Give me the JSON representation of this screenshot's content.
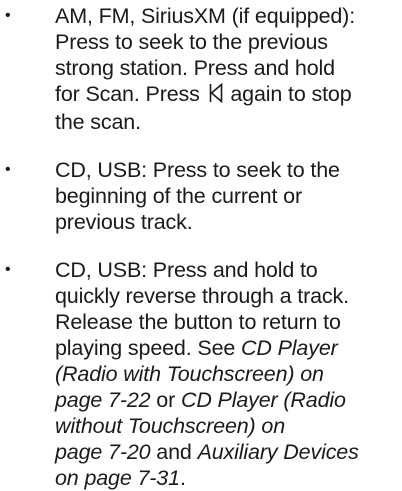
{
  "bullet_char": "•",
  "items": [
    {
      "lines": [
        {
          "text": "AM, FM, SiriusXM (if equipped):"
        },
        {
          "text": "Press to seek to the previous"
        },
        {
          "text": "strong station. Press and hold"
        },
        {
          "pre": "for Scan. Press ",
          "icon": "seek-back-icon",
          "post": " again to stop"
        },
        {
          "text": "the scan."
        }
      ]
    },
    {
      "lines": [
        {
          "text": "CD, USB: Press to seek to the"
        },
        {
          "text": "beginning of the current or"
        },
        {
          "text": "previous track."
        }
      ]
    },
    {
      "lines": [
        {
          "text": "CD, USB: Press and hold to"
        },
        {
          "text": "quickly reverse through a track."
        },
        {
          "text": "Release the button to return to"
        },
        {
          "pre": "playing speed. See ",
          "ref": "CD Player"
        },
        {
          "ref": "(Radio with Touchscreen) on"
        },
        {
          "ref": "page 7-22",
          "post": " or ",
          "ref2": "CD Player (Radio"
        },
        {
          "ref": "without Touchscreen) on"
        },
        {
          "ref": "page 7-20",
          "post": " and ",
          "ref2": "Auxiliary Devices"
        },
        {
          "ref": "on page 7-31",
          "post": "."
        }
      ]
    }
  ]
}
